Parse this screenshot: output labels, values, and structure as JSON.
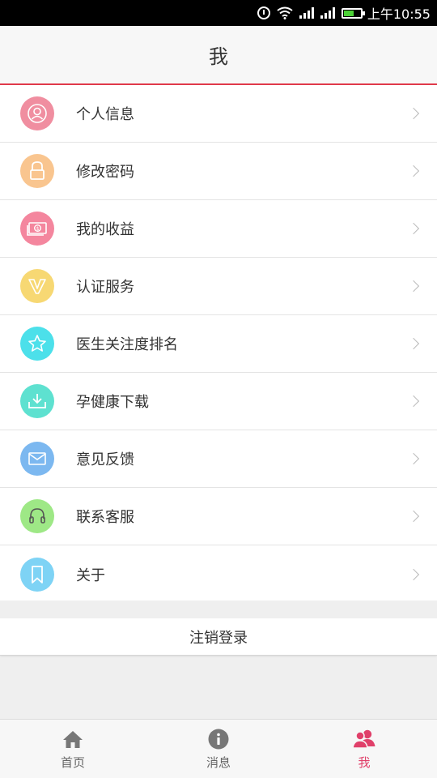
{
  "status_bar": {
    "time": "上午10:55",
    "icons": [
      "alarm-icon",
      "wifi-icon",
      "signal-icon",
      "signal-icon",
      "battery-icon"
    ]
  },
  "header": {
    "title": "我"
  },
  "menu": {
    "items": [
      {
        "label": "个人信息",
        "icon": "user-icon",
        "color": "#f08ea0"
      },
      {
        "label": "修改密码",
        "icon": "lock-icon",
        "color": "#f9c58f"
      },
      {
        "label": "我的收益",
        "icon": "money-icon",
        "color": "#f4869e"
      },
      {
        "label": "认证服务",
        "icon": "verified-icon",
        "color": "#f7d873"
      },
      {
        "label": "医生关注度排名",
        "icon": "star-icon",
        "color": "#4ce0ea"
      },
      {
        "label": "孕健康下载",
        "icon": "download-icon",
        "color": "#5ee1d0"
      },
      {
        "label": "意见反馈",
        "icon": "mail-icon",
        "color": "#7cb8f0"
      },
      {
        "label": "联系客服",
        "icon": "headset-icon",
        "color": "#9ee886"
      },
      {
        "label": "关于",
        "icon": "bookmark-icon",
        "color": "#7ed3f5"
      }
    ]
  },
  "logout": {
    "label": "注销登录"
  },
  "bottom_nav": {
    "tabs": [
      {
        "label": "首页",
        "icon": "home-icon",
        "active": false
      },
      {
        "label": "消息",
        "icon": "info-icon",
        "active": false
      },
      {
        "label": "我",
        "icon": "users-icon",
        "active": true
      }
    ],
    "active_color": "#e0406a"
  }
}
